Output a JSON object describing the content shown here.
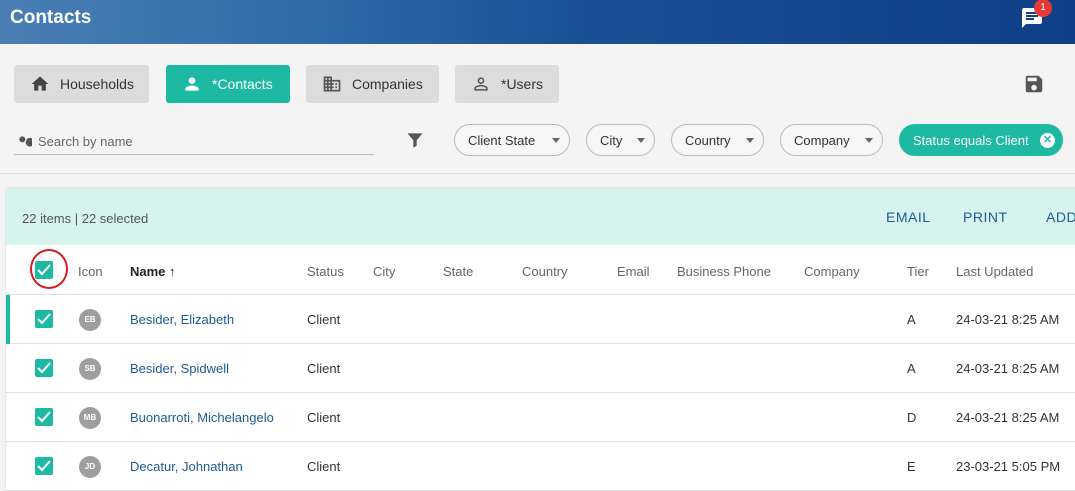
{
  "header": {
    "title": "Contacts",
    "chat_badge": "1"
  },
  "nav": {
    "households": "Households",
    "contacts": "*Contacts",
    "companies": "Companies",
    "users": "*Users"
  },
  "search": {
    "placeholder": "Search by name",
    "value": ""
  },
  "filters": {
    "client_state": "Client State",
    "city": "City",
    "country": "Country",
    "company": "Company",
    "active": "Status equals Client"
  },
  "selection": {
    "count_text": "22 items | 22 selected",
    "email": "EMAIL",
    "print": "PRINT",
    "add": "ADD"
  },
  "columns": {
    "icon": "Icon",
    "name": "Name",
    "status": "Status",
    "city": "City",
    "state": "State",
    "country": "Country",
    "email": "Email",
    "business_phone": "Business Phone",
    "company": "Company",
    "tier": "Tier",
    "last_updated": "Last Updated"
  },
  "rows": [
    {
      "initials": "EB",
      "name": "Besider, Elizabeth",
      "status": "Client",
      "tier": "A",
      "last_updated": "24-03-21 8:25 AM"
    },
    {
      "initials": "SB",
      "name": "Besider, Spidwell",
      "status": "Client",
      "tier": "A",
      "last_updated": "24-03-21 8:25 AM"
    },
    {
      "initials": "MB",
      "name": "Buonarroti, Michelangelo",
      "status": "Client",
      "tier": "D",
      "last_updated": "24-03-21 8:25 AM"
    },
    {
      "initials": "JD",
      "name": "Decatur, Johnathan",
      "status": "Client",
      "tier": "E",
      "last_updated": "23-03-21 5:05 PM"
    }
  ],
  "colors": {
    "accent": "#1db9a2",
    "link": "#1e5a94",
    "selection_bg": "#d6f3ee"
  }
}
